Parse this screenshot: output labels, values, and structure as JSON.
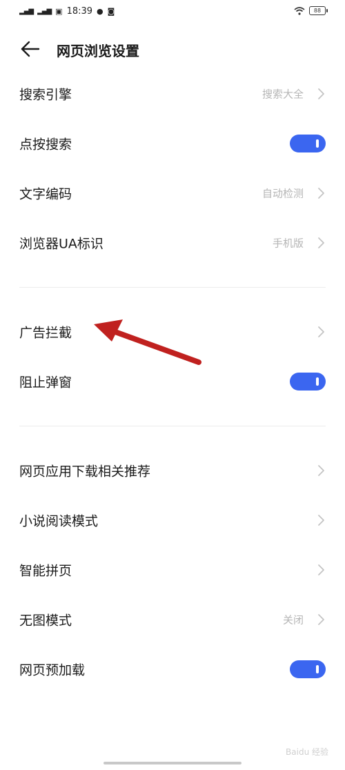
{
  "status_bar": {
    "sig1": "4G",
    "sig2": "4G",
    "time": "18:39",
    "battery": "88"
  },
  "header": {
    "title": "网页浏览设置"
  },
  "settings": [
    {
      "label": "搜索引擎",
      "value": "搜索大全",
      "type": "chevron"
    },
    {
      "label": "点按搜索",
      "value": "",
      "type": "toggle"
    },
    {
      "label": "文字编码",
      "value": "自动检测",
      "type": "chevron"
    },
    {
      "label": "浏览器UA标识",
      "value": "手机版",
      "type": "chevron"
    },
    {
      "label": "广告拦截",
      "value": "",
      "type": "chevron"
    },
    {
      "label": "阻止弹窗",
      "value": "",
      "type": "toggle"
    },
    {
      "label": "网页应用下载相关推荐",
      "value": "",
      "type": "chevron"
    },
    {
      "label": "小说阅读模式",
      "value": "",
      "type": "chevron"
    },
    {
      "label": "智能拼页",
      "value": "",
      "type": "chevron"
    },
    {
      "label": "无图模式",
      "value": "关闭",
      "type": "chevron"
    },
    {
      "label": "网页预加载",
      "value": "",
      "type": "toggle"
    }
  ],
  "colors": {
    "accent": "#3b66f0",
    "annotation_arrow": "#c0211f"
  },
  "watermark": "Baidu 经验"
}
